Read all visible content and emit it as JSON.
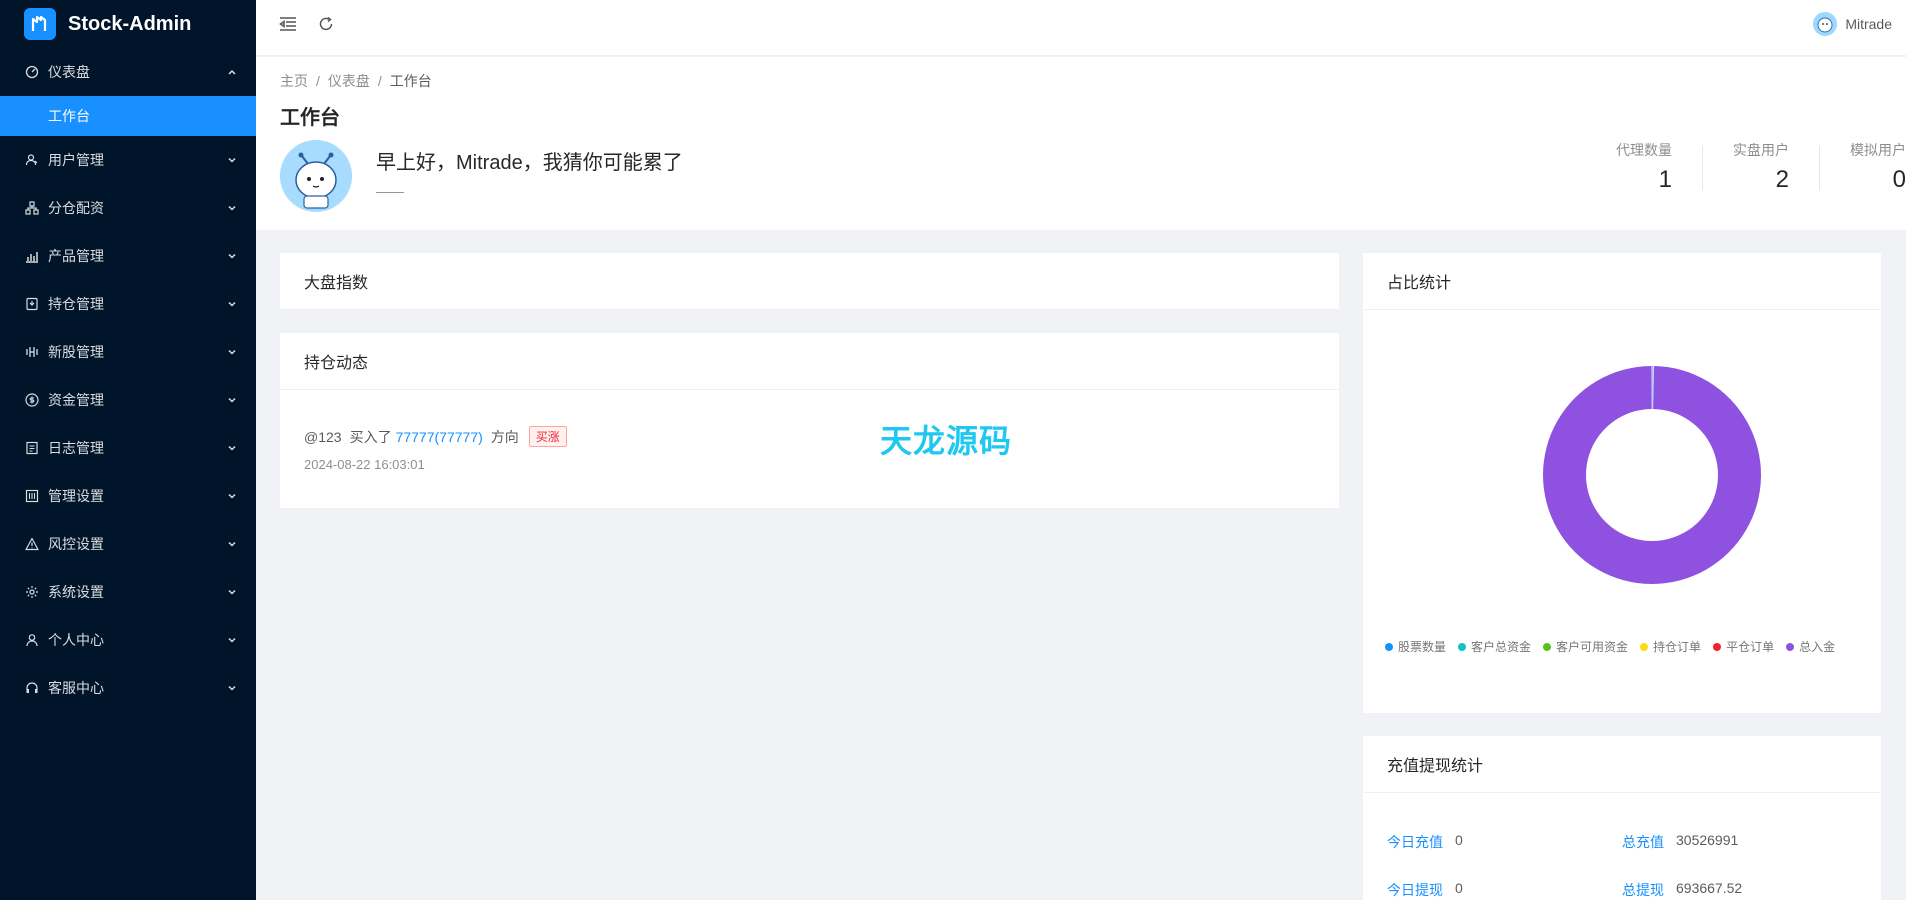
{
  "app": {
    "name": "Stock-Admin"
  },
  "sidebar": {
    "items": [
      {
        "label": "仪表盘",
        "icon": "dashboard-icon",
        "expanded": true,
        "children": [
          {
            "label": "工作台",
            "active": true
          }
        ]
      },
      {
        "label": "用户管理",
        "icon": "user-manage-icon"
      },
      {
        "label": "分仓配资",
        "icon": "cluster-icon"
      },
      {
        "label": "产品管理",
        "icon": "chart-icon"
      },
      {
        "label": "持仓管理",
        "icon": "position-icon"
      },
      {
        "label": "新股管理",
        "icon": "ipo-icon"
      },
      {
        "label": "资金管理",
        "icon": "money-icon"
      },
      {
        "label": "日志管理",
        "icon": "log-icon"
      },
      {
        "label": "管理设置",
        "icon": "settings-panel-icon"
      },
      {
        "label": "风控设置",
        "icon": "warning-icon"
      },
      {
        "label": "系统设置",
        "icon": "gear-icon"
      },
      {
        "label": "个人中心",
        "icon": "person-icon"
      },
      {
        "label": "客服中心",
        "icon": "headset-icon"
      }
    ]
  },
  "header": {
    "username": "Mitrade"
  },
  "breadcrumb": [
    "主页",
    "仪表盘",
    "工作台"
  ],
  "page": {
    "title": "工作台"
  },
  "welcome": {
    "greeting": "早上好，Mitrade，我猜你可能累了",
    "sub": "——"
  },
  "stats": [
    {
      "label": "代理数量",
      "value": "1"
    },
    {
      "label": "实盘用户",
      "value": "2"
    },
    {
      "label": "模拟用户",
      "value": "0"
    }
  ],
  "cards": {
    "index": {
      "title": "大盘指数"
    },
    "positions": {
      "title": "持仓动态"
    },
    "ratio": {
      "title": "占比统计"
    },
    "funds": {
      "title": "充值提现统计"
    }
  },
  "trade": {
    "user": "@123",
    "action": "买入了",
    "stock": "77777(77777)",
    "direction_label": "方向",
    "direction": "买涨",
    "time": "2024-08-22 16:03:01"
  },
  "watermark": "天龙源码",
  "chart_data": {
    "type": "pie",
    "categories": [
      "股票数量",
      "客户总资金",
      "客户可用资金",
      "持仓订单",
      "平仓订单",
      "总入金"
    ],
    "colors": [
      "#1890ff",
      "#13c2c2",
      "#52c41a",
      "#fadb14",
      "#f5222d",
      "#8f52e0"
    ],
    "values": [
      0.2,
      0,
      0,
      0,
      0,
      99.8
    ],
    "donut": true,
    "legend": "bottom"
  },
  "funds": [
    {
      "label": "今日充值",
      "value": "0"
    },
    {
      "label": "总充值",
      "value": "30526991"
    },
    {
      "label": "今日提现",
      "value": "0"
    },
    {
      "label": "总提现",
      "value": "693667.52"
    }
  ]
}
